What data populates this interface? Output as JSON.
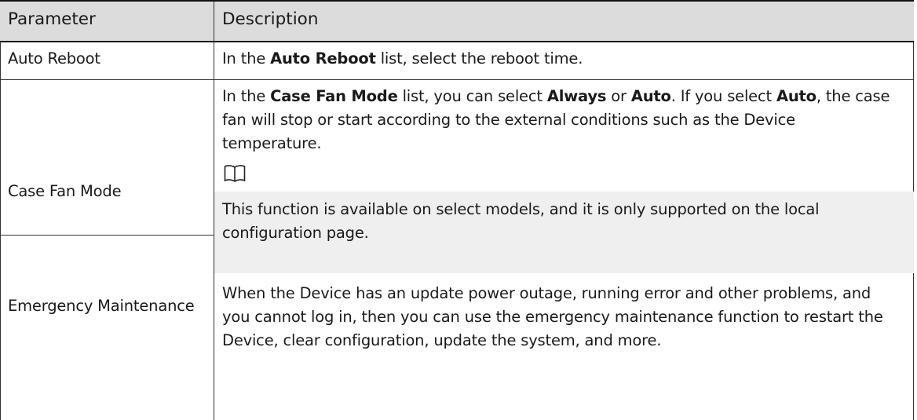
{
  "header": {
    "param": "Parameter",
    "desc": "Description"
  },
  "rows": [
    {
      "param": "Auto Reboot",
      "desc": {
        "p1": "In the ",
        "b1": "Auto Reboot",
        "p2": "  list, select the reboot time."
      }
    },
    {
      "param": "Case Fan Mode",
      "desc": {
        "p1": "In the ",
        "b1": "Case Fan Mode",
        "p2": "  list, you can select ",
        "b2": "Always",
        "p3": " or ",
        "b3": "Auto",
        "p4": ". If you select ",
        "b4": "Auto",
        "p5": ", the case fan will stop or start according to the external conditions such as the Device temperature."
      },
      "note_icon": "book-icon",
      "note": "This function is available on select models, and it is only supported on the local configuration page."
    },
    {
      "param": "Emergency Maintenance",
      "desc": "When the Device has an update power outage, running error and other problems, and you cannot log in, then you can use the emergency maintenance function to restart the Device, clear configuration, update the system, and more."
    }
  ]
}
